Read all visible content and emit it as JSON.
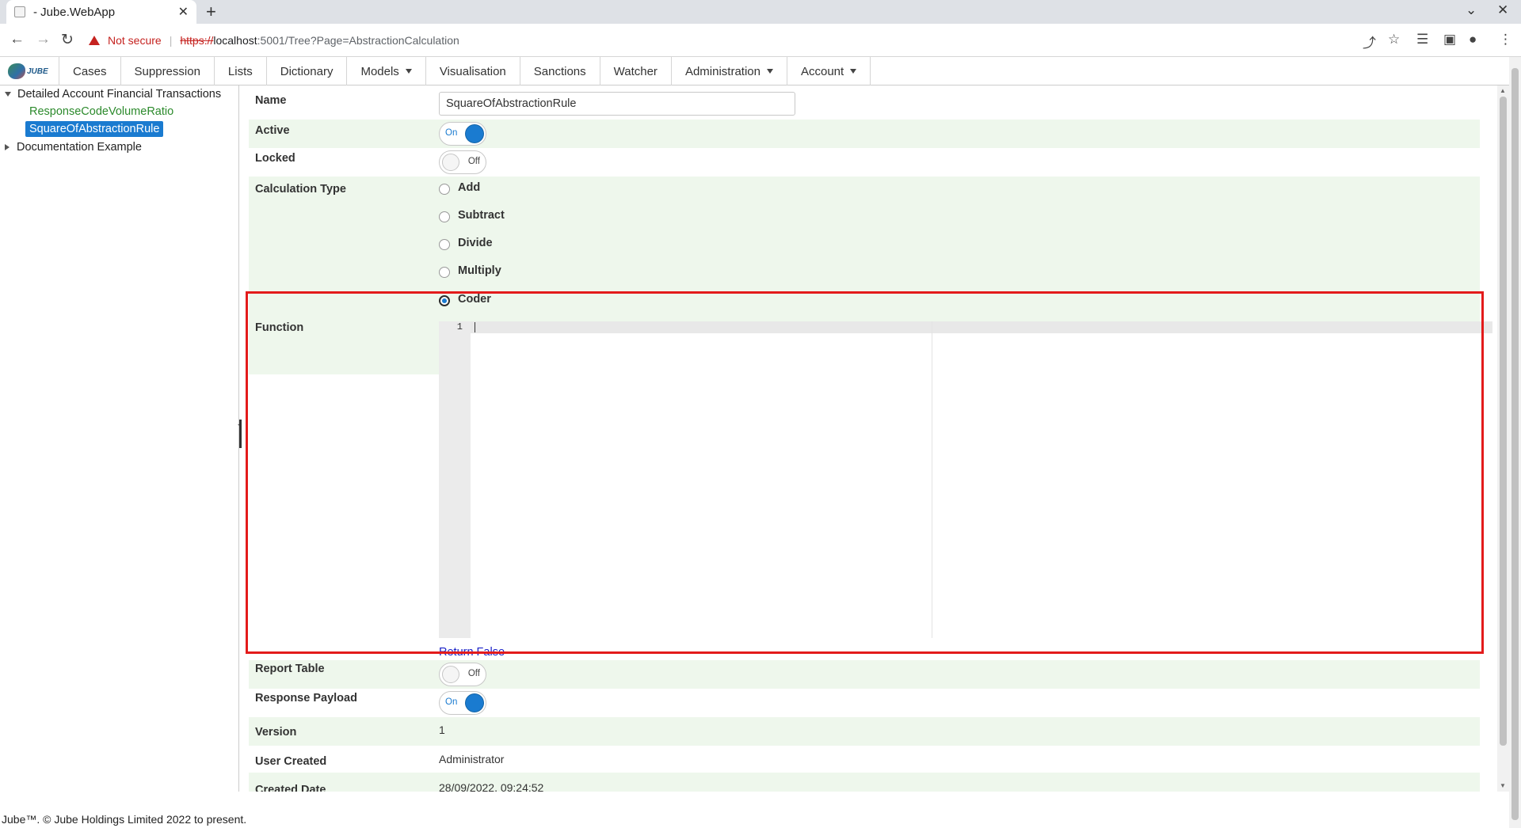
{
  "browser": {
    "tab_title": "- Jube.WebApp",
    "security_label": "Not secure",
    "url_scheme": "https://",
    "url_host": "localhost",
    "url_path": ":5001/Tree?Page=AbstractionCalculation"
  },
  "nav": {
    "logo_text": "JUBE",
    "items": [
      {
        "label": "Cases",
        "dropdown": false
      },
      {
        "label": "Suppression",
        "dropdown": false
      },
      {
        "label": "Lists",
        "dropdown": false
      },
      {
        "label": "Dictionary",
        "dropdown": false
      },
      {
        "label": "Models",
        "dropdown": true
      },
      {
        "label": "Visualisation",
        "dropdown": false
      },
      {
        "label": "Sanctions",
        "dropdown": false
      },
      {
        "label": "Watcher",
        "dropdown": false
      },
      {
        "label": "Administration",
        "dropdown": true
      },
      {
        "label": "Account",
        "dropdown": true
      }
    ]
  },
  "tree": {
    "group1": "Detailed Account Financial Transactions",
    "leaf1": "ResponseCodeVolumeRatio",
    "leaf2": "SquareOfAbstractionRule",
    "group2": "Documentation Example"
  },
  "form": {
    "name_label": "Name",
    "name_value": "SquareOfAbstractionRule",
    "active_label": "Active",
    "active_state": "On",
    "locked_label": "Locked",
    "locked_state": "Off",
    "calc_type_label": "Calculation Type",
    "calc_options": [
      "Add",
      "Subtract",
      "Divide",
      "Multiply",
      "Coder"
    ],
    "calc_selected": "Coder",
    "function_label": "Function",
    "editor_line_number": "1",
    "return_false_link": "Return False",
    "report_table_label": "Report Table",
    "report_table_state": "Off",
    "response_payload_label": "Response Payload",
    "response_payload_state": "On",
    "version_label": "Version",
    "version_value": "1",
    "user_created_label": "User Created",
    "user_created_value": "Administrator",
    "created_date_label": "Created Date",
    "created_date_value": "28/09/2022, 09:24:52"
  },
  "footer": {
    "text": "Jube™. © Jube Holdings Limited 2022 to present."
  },
  "colors": {
    "accent": "#1a7bd0",
    "band": "#eef7ec",
    "highlight": "#e31b1b",
    "tree_leaf": "#2c8a2c"
  }
}
